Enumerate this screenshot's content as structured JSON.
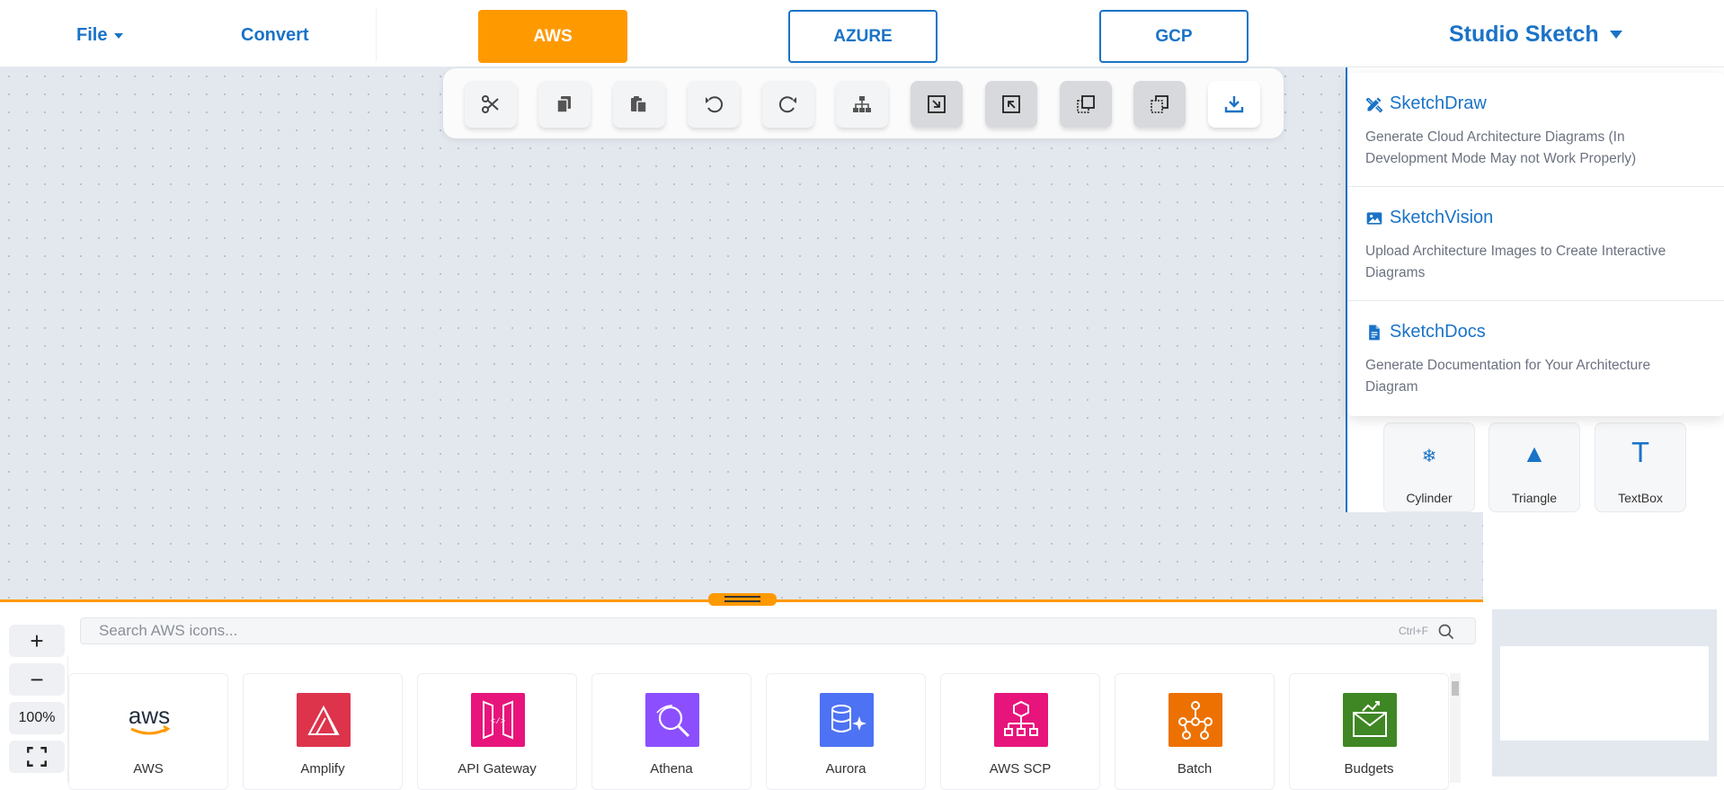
{
  "topbar": {
    "file_label": "File",
    "convert_label": "Convert",
    "clouds": [
      "AWS",
      "AZURE",
      "GCP"
    ],
    "studio_label": "Studio Sketch"
  },
  "toolbar": {
    "tools": [
      "cut-icon",
      "copy-icon",
      "paste-icon",
      "undo-icon",
      "redo-icon",
      "layout-icon",
      "group-icon",
      "ungroup-icon",
      "bring-front-icon",
      "send-back-icon",
      "download-icon"
    ]
  },
  "studio_menu": {
    "items": [
      {
        "title": "SketchDraw",
        "desc": "Generate Cloud Architecture Diagrams (In Development Mode May not Work Properly)",
        "icon": "pencil-ruler-icon"
      },
      {
        "title": "SketchVision",
        "desc": "Upload Architecture Images to Create Interactive Diagrams",
        "icon": "image-icon"
      },
      {
        "title": "SketchDocs",
        "desc": "Generate Documentation for Your Architecture Diagram",
        "icon": "document-icon"
      }
    ]
  },
  "shapes": [
    {
      "label": "Cylinder",
      "glyph": "❄"
    },
    {
      "label": "Triangle",
      "glyph": "▲"
    },
    {
      "label": "TextBox",
      "glyph": "T"
    }
  ],
  "zoom": {
    "plus": "+",
    "minus": "−",
    "level": "100%"
  },
  "search": {
    "placeholder": "Search AWS icons...",
    "shortcut": "Ctrl+F"
  },
  "aws_services": [
    {
      "label": "AWS",
      "color": "#ffffff"
    },
    {
      "label": "Amplify",
      "color": "#dd344c"
    },
    {
      "label": "API Gateway",
      "color": "#e7157b"
    },
    {
      "label": "Athena",
      "color": "#8c4fff"
    },
    {
      "label": "Aurora",
      "color": "#4d72f3"
    },
    {
      "label": "AWS SCP",
      "color": "#e7157b"
    },
    {
      "label": "Batch",
      "color": "#ed7100"
    },
    {
      "label": "Budgets",
      "color": "#3f8624"
    }
  ],
  "colors": {
    "accent": "#1a73c7",
    "aws_orange": "#ff9900"
  }
}
